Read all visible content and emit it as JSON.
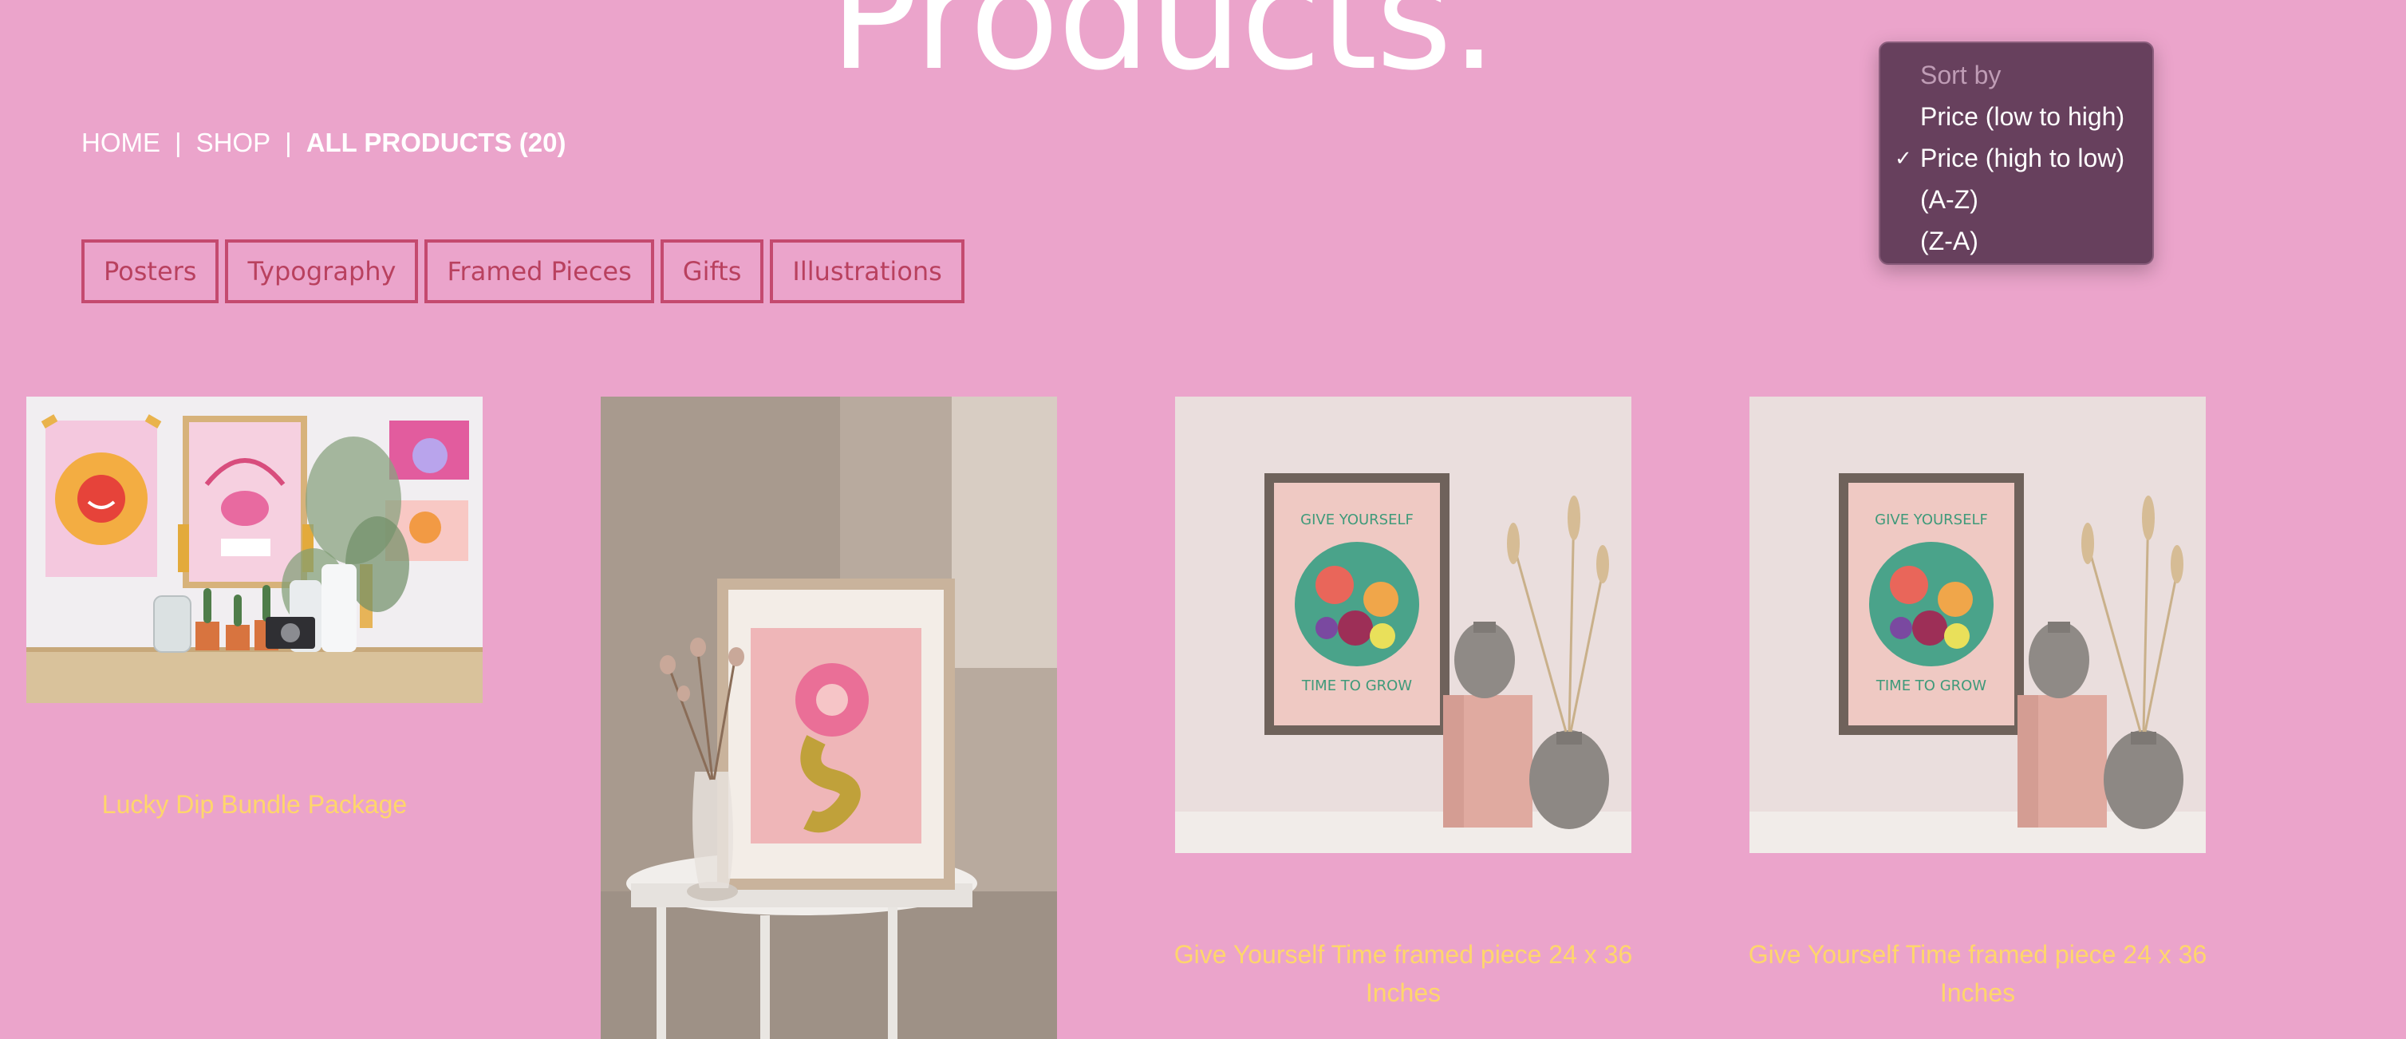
{
  "page": {
    "title": "Products."
  },
  "breadcrumb": {
    "home": "HOME",
    "separator": "|",
    "shop": "SHOP",
    "current": "ALL PRODUCTS (20)"
  },
  "filters": [
    {
      "label": "Posters"
    },
    {
      "label": "Typography"
    },
    {
      "label": "Framed Pieces"
    },
    {
      "label": "Gifts"
    },
    {
      "label": "Illustrations"
    }
  ],
  "sort": {
    "header": "Sort by",
    "check_glyph": "✓",
    "options": [
      {
        "label": "Price (low to high)",
        "selected": false
      },
      {
        "label": "Price (high to low)",
        "selected": true
      },
      {
        "label": "(A-Z)",
        "selected": false
      },
      {
        "label": "(Z-A)",
        "selected": false
      }
    ]
  },
  "products": [
    {
      "title": "Lucky Dip Bundle Package"
    },
    {
      "title": ""
    },
    {
      "title": "Give Yourself Time framed piece 24 x 36 Inches"
    },
    {
      "title": "Give Yourself Time framed piece 24 x 36 Inches"
    }
  ],
  "colors": {
    "background": "#eba4cb",
    "accent_border": "#c44a6f",
    "product_title": "#ffd66c",
    "menu_background": "#67405d"
  }
}
